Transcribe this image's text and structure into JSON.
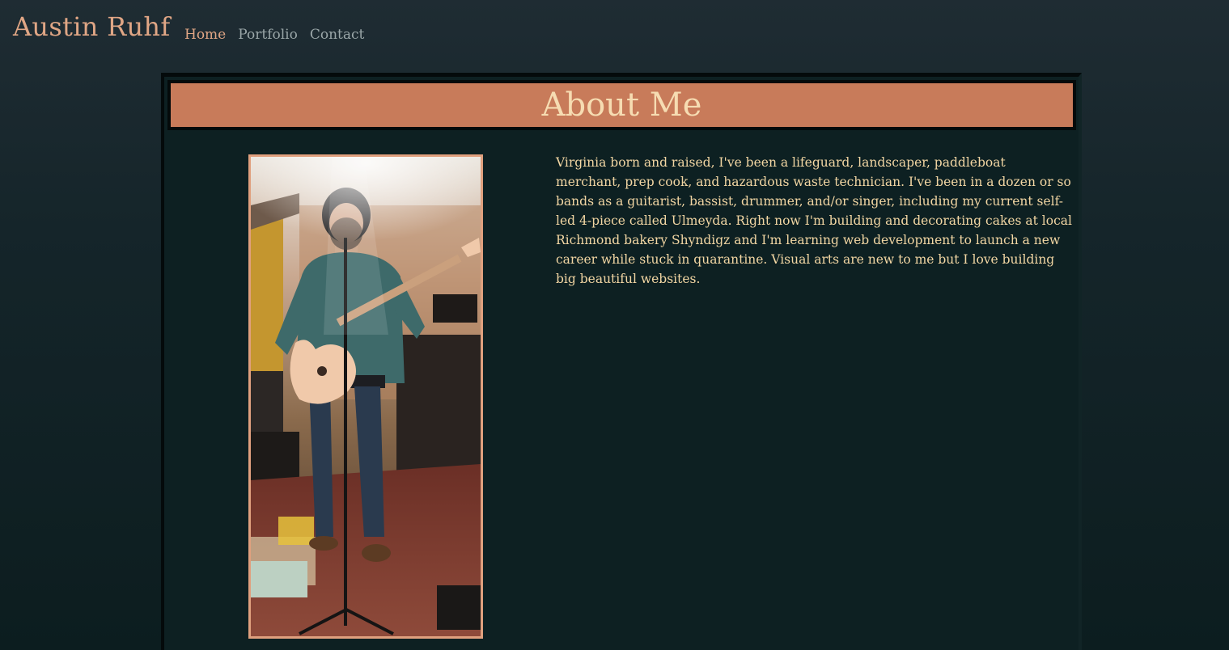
{
  "header": {
    "brand": "Austin Ruhf",
    "nav": [
      {
        "label": "Home",
        "active": true
      },
      {
        "label": "Portfolio",
        "active": false
      },
      {
        "label": "Contact",
        "active": false
      }
    ]
  },
  "about": {
    "title": "About Me",
    "bio": "Virginia born and raised, I've been a lifeguard, landscaper, paddleboat merchant, prep cook, and hazardous waste technician. I've been in a dozen or so bands as a guitarist, bassist, drummer, and/or singer, including my current self-led 4-piece called Ulmeyda. Right now I'm building and decorating cakes at local Richmond bakery Shyndigz and I'm learning web development to launch a new career while stuck in quarantine. Visual arts are new to me but I love building big beautiful websites."
  },
  "colors": {
    "accent": "#c87b5a",
    "brand_text": "#e0a685",
    "title_text": "#f6dcb2",
    "body_text": "#f2d6a3",
    "nav_inactive": "#9aa6a8"
  }
}
